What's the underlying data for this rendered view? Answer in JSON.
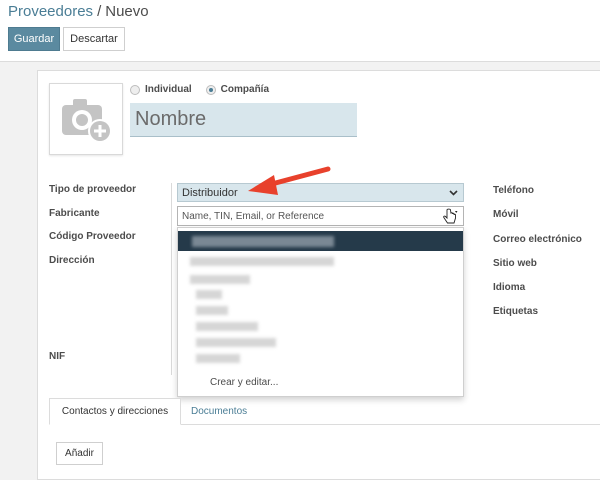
{
  "breadcrumb": {
    "parent": "Proveedores",
    "separator": "/",
    "current": "Nuevo"
  },
  "toolbar": {
    "save_label": "Guardar",
    "discard_label": "Descartar"
  },
  "company_type": {
    "options": [
      "Individual",
      "Compañía"
    ],
    "selected": "Compañía"
  },
  "name": {
    "placeholder": "Nombre"
  },
  "left_fields": {
    "supplier_type_label": "Tipo de proveedor",
    "manufacturer_label": "Fabricante",
    "supplier_code_label": "Código Proveedor",
    "address_label": "Dirección",
    "nif_label": "NIF"
  },
  "supplier_type": {
    "value": "Distribuidor"
  },
  "manufacturer": {
    "placeholder": "Name, TIN, Email, or Reference"
  },
  "dropdown": {
    "create_edit_label": "Crear y editar..."
  },
  "right_fields": {
    "phone_label": "Teléfono",
    "mobile_label": "Móvil",
    "email_label": "Correo electrónico",
    "website_label": "Sitio web",
    "language_label": "Idioma",
    "tags_label": "Etiquetas"
  },
  "tabs": [
    "Contactos y direcciones",
    "Documentos"
  ],
  "add_button_label": "Añadir",
  "colors": {
    "primary": "#5b8aa0",
    "link": "#4a7d95",
    "highlight_field": "#d8e6ec",
    "annotation_arrow": "#e8412c",
    "dropdown_active": "#253a4a"
  }
}
